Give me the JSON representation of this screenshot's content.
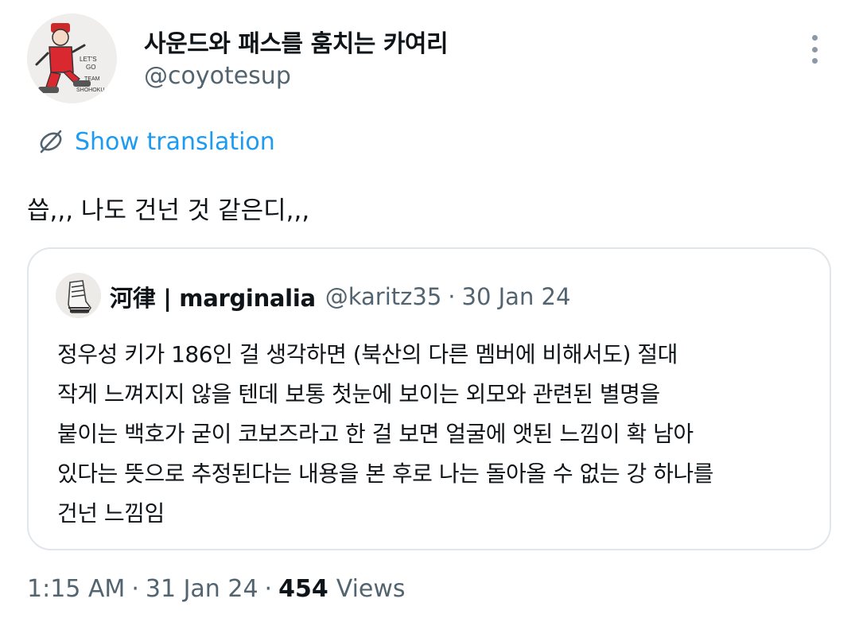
{
  "author": {
    "display_name": "사운드와 패스를 훔치는 카여리",
    "handle": "@coyotesup",
    "avatar_icon": "avatar-icon"
  },
  "menu": {
    "more_icon": "more-horizontal-icon"
  },
  "translation": {
    "label": "Show translation",
    "icon": "globe-icon"
  },
  "tweet": {
    "text": "씁,,, 나도 건넌 것 같은디,,,"
  },
  "quote": {
    "display_name": "河律 | marginalia",
    "handle": "@karitz35",
    "separator": "·",
    "date": "30 Jan 24",
    "lines": [
      "정우성 키가 186인 걸 생각하면 (북산의 다른 멤버에 비해서도) 절대",
      "작게 느껴지지 않을 텐데 보통 첫눈에 보이는 외모와 관련된 별명을",
      "붙이는 백호가 굳이 코보즈라고 한 걸 보면 얼굴에 앳된 느낌이 확 남아",
      "있다는 뜻으로 추정된다는 내용을 본 후로 나는 돌아올 수 없는 강 하나를",
      "건넌 느낌임"
    ]
  },
  "meta": {
    "time": "1:15 AM",
    "date": "31 Jan 24",
    "separator": "·",
    "views_count": "454",
    "views_label": "Views"
  },
  "colors": {
    "link": "#1d9bf0",
    "muted": "#536471",
    "text": "#0f1419",
    "border": "#e1e6ea"
  }
}
